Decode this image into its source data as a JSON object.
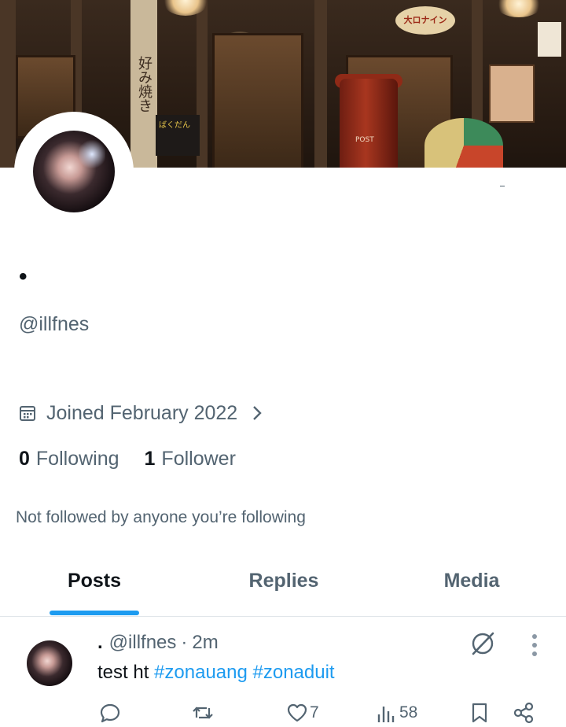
{
  "banner": {
    "vertical_sign": "好み焼き",
    "shop_sign": "大ロナイン",
    "postbox_text": "POST",
    "board_text": "ばくだん"
  },
  "profile": {
    "display_name": "•",
    "handle": "@illfnes",
    "joined": "Joined February 2022",
    "following_count": "0",
    "following_label": "Following",
    "followers_count": "1",
    "followers_label": "Follower",
    "not_followed_note": "Not followed by anyone you’re following"
  },
  "tabs": [
    {
      "label": "Posts",
      "active": true
    },
    {
      "label": "Replies",
      "active": false
    },
    {
      "label": "Media",
      "active": false
    }
  ],
  "post": {
    "author_name": ".",
    "author_handle": "@illfnes",
    "separator": "·",
    "time": "2m",
    "text_plain": "test ht",
    "hashtag_1": "#zonauang",
    "hashtag_2": "#zonaduit",
    "actions": {
      "reply": {
        "icon": "reply-icon",
        "count": ""
      },
      "repost": {
        "icon": "repost-icon",
        "count": ""
      },
      "like": {
        "icon": "heart-icon",
        "count": "7"
      },
      "views": {
        "icon": "views-icon",
        "count": "58"
      },
      "bookmark": {
        "icon": "bookmark-icon",
        "count": ""
      },
      "share": {
        "icon": "share-icon",
        "count": ""
      }
    }
  },
  "colors": {
    "accent": "#1d9bf0",
    "text": "#0f1419",
    "muted": "#536471"
  }
}
